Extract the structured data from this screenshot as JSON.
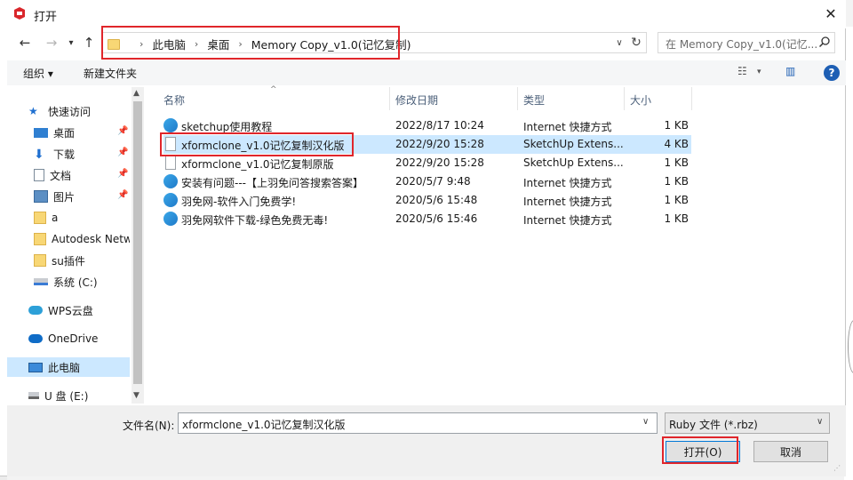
{
  "window": {
    "title": "打开",
    "close_label": "✕"
  },
  "address": {
    "crumbs": [
      "此电脑",
      "桌面",
      "Memory Copy_v1.0(记忆复制)"
    ]
  },
  "search": {
    "placeholder": "在 Memory Copy_v1.0(记忆..."
  },
  "toolbar": {
    "organize_label": "组织 ▾",
    "new_folder_label": "新建文件夹"
  },
  "sidebar": {
    "items": [
      {
        "label": "快速访问",
        "icon": "star-icon"
      },
      {
        "label": "桌面",
        "icon": "desktop-icon",
        "pinned": true
      },
      {
        "label": "下载",
        "icon": "download-icon",
        "pinned": true
      },
      {
        "label": "文档",
        "icon": "document-icon",
        "pinned": true
      },
      {
        "label": "图片",
        "icon": "picture-icon",
        "pinned": true
      },
      {
        "label": "a",
        "icon": "folder-icon"
      },
      {
        "label": "Autodesk Netw",
        "icon": "folder-icon"
      },
      {
        "label": "su插件",
        "icon": "folder-icon"
      },
      {
        "label": "系统 (C:)",
        "icon": "drive-icon"
      },
      {
        "label": "WPS云盘",
        "icon": "cloud-icon"
      },
      {
        "label": "OneDrive",
        "icon": "cloud-icon"
      },
      {
        "label": "此电脑",
        "icon": "computer-icon",
        "selected": true
      },
      {
        "label": "U 盘 (E:)",
        "icon": "usb-drive-icon"
      }
    ]
  },
  "files": {
    "columns": [
      "名称",
      "修改日期",
      "类型",
      "大小"
    ],
    "rows": [
      {
        "name": "sketchup使用教程",
        "date": "2022/8/17 10:24",
        "type": "Internet 快捷方式",
        "size": "1 KB",
        "icon": "url-icon"
      },
      {
        "name": "xformclone_v1.0记忆复制汉化版",
        "date": "2022/9/20 15:28",
        "type": "SketchUp Extens...",
        "size": "4 KB",
        "icon": "file-icon",
        "selected": true
      },
      {
        "name": "xformclone_v1.0记忆复制原版",
        "date": "2022/9/20 15:28",
        "type": "SketchUp Extens...",
        "size": "1 KB",
        "icon": "file-icon"
      },
      {
        "name": "安装有问题---【上羽免问答搜索答案】",
        "date": "2020/5/7 9:48",
        "type": "Internet 快捷方式",
        "size": "1 KB",
        "icon": "url-icon"
      },
      {
        "name": "羽免网-软件入门免费学!",
        "date": "2020/5/6 15:48",
        "type": "Internet 快捷方式",
        "size": "1 KB",
        "icon": "url-icon"
      },
      {
        "name": "羽免网软件下载-绿色免费无毒!",
        "date": "2020/5/6 15:46",
        "type": "Internet 快捷方式",
        "size": "1 KB",
        "icon": "url-icon"
      }
    ]
  },
  "footer": {
    "filename_label": "文件名(N):",
    "filename_value": "xformclone_v1.0记忆复制汉化版",
    "filetype_value": "Ruby 文件 (*.rbz)",
    "open_label": "打开(O)",
    "cancel_label": "取消"
  },
  "colors": {
    "accent": "#0078d7",
    "selection": "#cce8ff",
    "highlight_box": "#e0262b"
  }
}
